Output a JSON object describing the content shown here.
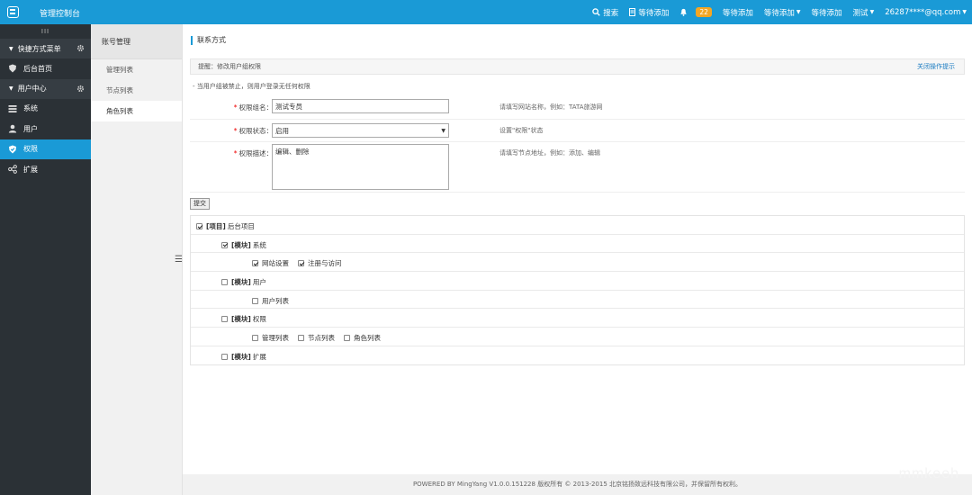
{
  "app": {
    "title": "管理控制台"
  },
  "topnav": {
    "search": "搜索",
    "pending1": "等待添加",
    "badge_count": "22",
    "pending2": "等待添加",
    "pending3": "等待添加",
    "pending4": "等待添加",
    "test": "测试",
    "user": "26287****@qq.com"
  },
  "sidebar": {
    "grip": "III",
    "quick_menu": "快捷方式菜单",
    "home": "后台首页",
    "user_center": "用户中心",
    "items": [
      {
        "label": "系统",
        "icon": "list-icon"
      },
      {
        "label": "用户",
        "icon": "user-icon"
      },
      {
        "label": "权限",
        "icon": "shield-icon"
      },
      {
        "label": "扩展",
        "icon": "share-icon"
      }
    ]
  },
  "subnav": {
    "title": "账号管理",
    "items": [
      "管理列表",
      "节点列表",
      "角色列表"
    ]
  },
  "main": {
    "page_title": "联系方式",
    "tip": "提醒：修改用户组权限",
    "tip_close": "关闭操作提示",
    "note": "- 当用户组被禁止，则用户登录无任何权限",
    "form": {
      "name_label": "权限组名：",
      "name_value": "测试专员",
      "name_help": "请填写网站名称，例如：TATA旅游网",
      "status_label": "权限状态：",
      "status_value": "启用",
      "status_help": "设置\"权限\"状态",
      "desc_label": "权限描述：",
      "desc_value": "编辑、删除",
      "desc_help": "请填写节点地址，例如：添加、编辑"
    },
    "submit": "提交",
    "tree": {
      "project_tag": "[项目]",
      "project_name": "后台项目",
      "module_tag": "[模块]",
      "system": "系统",
      "site_settings": "网站设置",
      "register_access": "注册与访问",
      "user": "用户",
      "user_list": "用户列表",
      "permission": "权限",
      "manage_list": "管理列表",
      "node_list": "节点列表",
      "role_list": "角色列表",
      "extend": "扩展"
    }
  },
  "footer": {
    "text": "POWERED BY MingYang V1.0.0.151228 版权所有 © 2013-2015 北京铭扬致远科技有限公司，并保留所有权利。"
  },
  "watermark": "mmkeeh",
  "colors": {
    "accent": "#1a9ad6",
    "sidebar": "#2b3136",
    "badge": "#f5a623"
  }
}
